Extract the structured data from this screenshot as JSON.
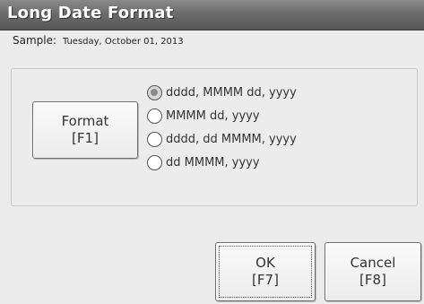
{
  "window": {
    "title": "Long Date Format"
  },
  "sample": {
    "label": "Sample:",
    "value": "Tuesday, October 01, 2013"
  },
  "format_button": {
    "line1": "Format",
    "line2": "[F1]"
  },
  "options": [
    {
      "label": "dddd, MMMM dd, yyyy",
      "selected": true
    },
    {
      "label": "MMMM dd, yyyy",
      "selected": false
    },
    {
      "label": "dddd, dd MMMM, yyyy",
      "selected": false
    },
    {
      "label": "dd MMMM, yyyy",
      "selected": false
    }
  ],
  "ok_button": {
    "line1": "OK",
    "line2": "[F7]"
  },
  "cancel_button": {
    "line1": "Cancel",
    "line2": "[F8]"
  }
}
